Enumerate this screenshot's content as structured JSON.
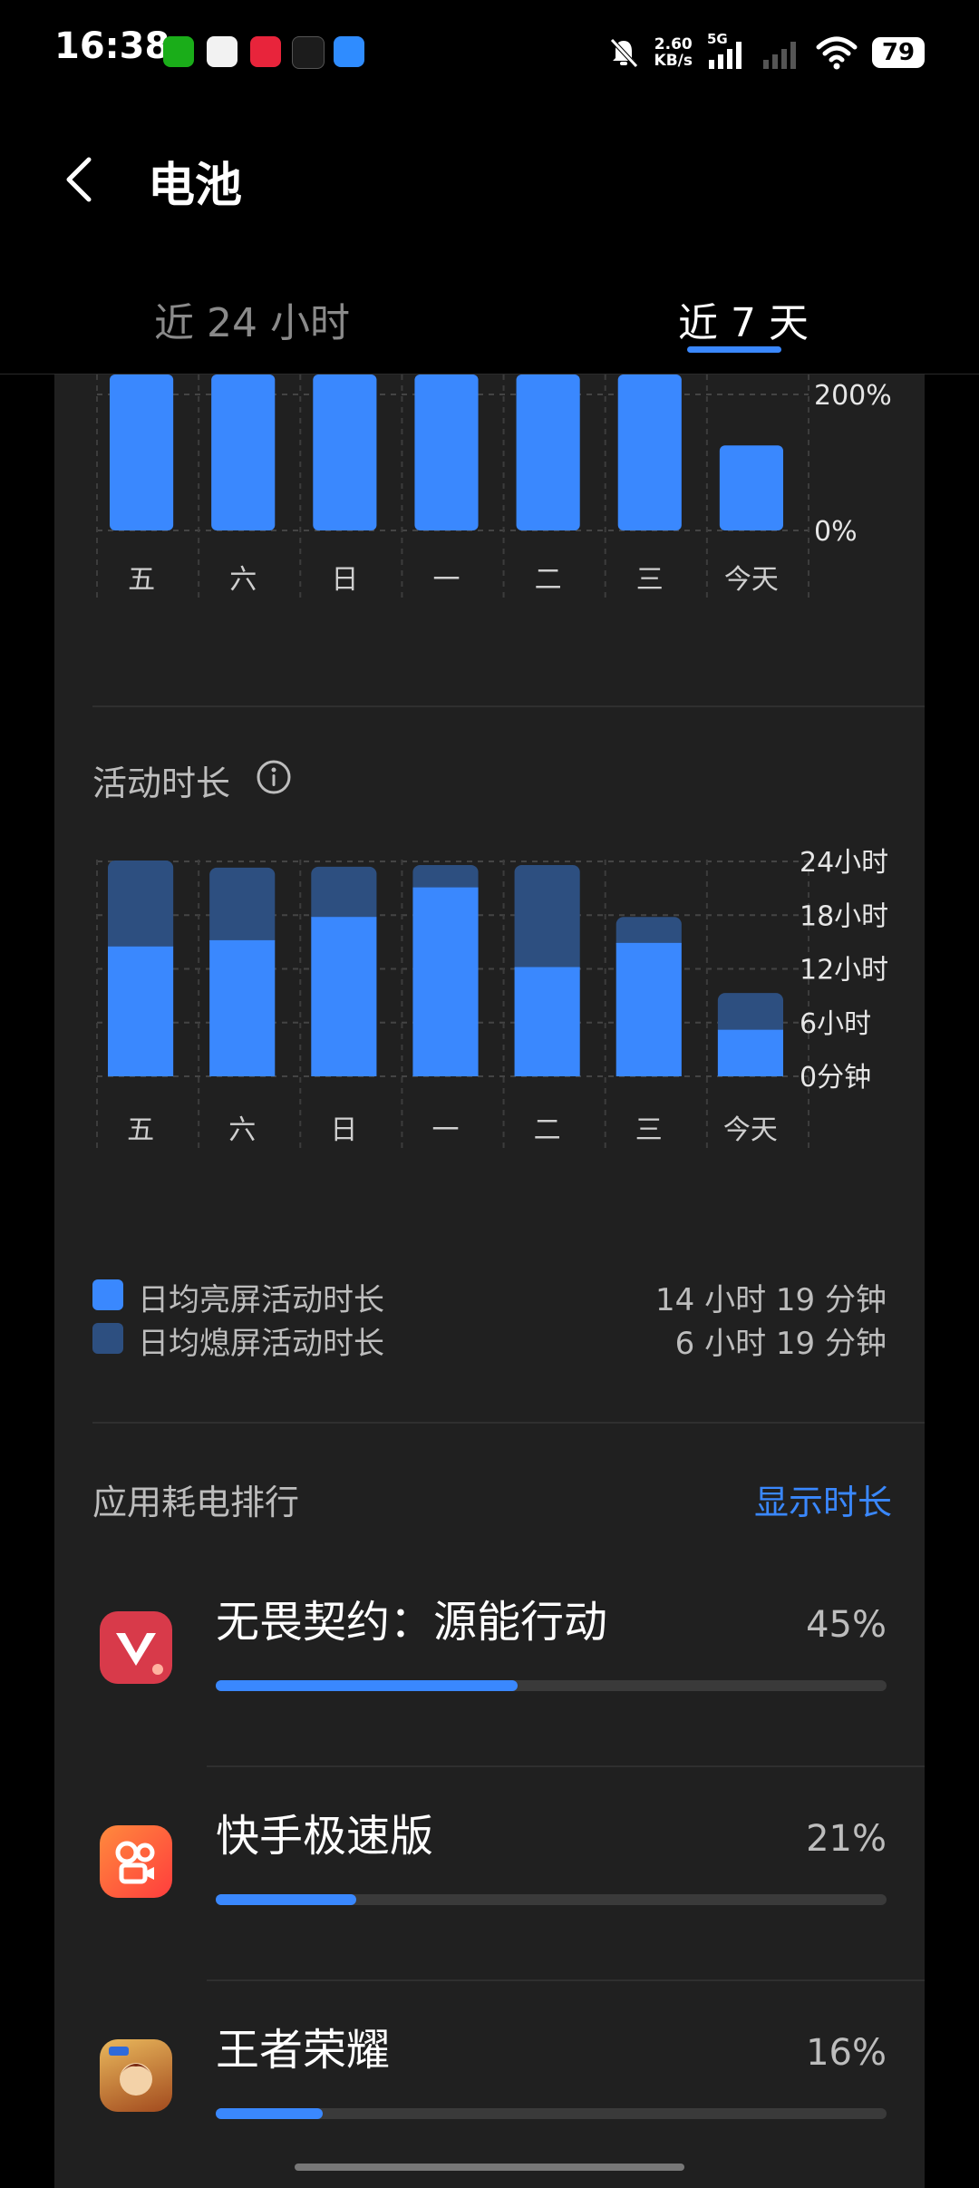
{
  "status_bar": {
    "time": "16:38",
    "net_speed_value": "2.60",
    "net_speed_unit": "KB/s",
    "network_type": "5G",
    "battery_level": "79",
    "app_icons": [
      "wechat-icon",
      "qq-icon",
      "xiaohongshu-icon",
      "dewu-icon",
      "feishu-icon"
    ],
    "right_icons": [
      "mute-bell-icon",
      "signal-icon",
      "signal-icon",
      "wifi-icon"
    ]
  },
  "header": {
    "title": "电池",
    "back_icon": "chevron-left-icon"
  },
  "tabs": [
    {
      "label": "近 24 小时",
      "active": false
    },
    {
      "label": "近 7 天",
      "active": true
    }
  ],
  "colors": {
    "accent": "#3a88fe",
    "screen_off": "#2d4f80",
    "card": "#202020",
    "background": "#000000"
  },
  "usage_chart": {
    "y_tick_labels": [
      "200%",
      "0%"
    ],
    "x_labels": [
      "五",
      "六",
      "日",
      "一",
      "二",
      "三",
      "今天"
    ]
  },
  "activity_section": {
    "title": "活动时长",
    "info_icon": "info-icon",
    "legend": [
      {
        "label": "日均亮屏活动时长",
        "value": "14 小时 19 分钟",
        "color": "#3a88fe"
      },
      {
        "label": "日均熄屏活动时长",
        "value": "6 小时 19 分钟",
        "color": "#2d4f80"
      }
    ]
  },
  "ranking": {
    "title": "应用耗电排行",
    "toggle_label": "显示时长",
    "apps": [
      {
        "name": "无畏契约：源能行动",
        "percent_label": "45%",
        "fraction": 0.45,
        "icon": "valorant-mobile-icon"
      },
      {
        "name": "快手极速版",
        "percent_label": "21%",
        "fraction": 0.21,
        "icon": "kuaishou-lite-icon"
      },
      {
        "name": "王者荣耀",
        "percent_label": "16%",
        "fraction": 0.16,
        "icon": "honor-of-kings-icon"
      }
    ]
  },
  "chart_data": [
    {
      "type": "bar",
      "categories": [
        "五",
        "六",
        "日",
        "一",
        "二",
        "三",
        "今天"
      ],
      "values": [
        290,
        290,
        290,
        290,
        290,
        290,
        125
      ],
      "ylim": [
        0,
        290
      ],
      "y_ticks": [
        0,
        200
      ],
      "tick_labels": [
        "0%",
        "200%"
      ],
      "grid": true,
      "color": "#3a88fe"
    },
    {
      "type": "bar",
      "stacked": true,
      "categories": [
        "五",
        "六",
        "日",
        "一",
        "二",
        "三",
        "今天"
      ],
      "series": [
        {
          "name": "日均亮屏活动时长",
          "values": [
            14.5,
            15.2,
            17.8,
            21.1,
            12.2,
            14.9,
            5.2
          ],
          "color": "#3a88fe"
        },
        {
          "name": "日均熄屏活动时长",
          "values": [
            9.6,
            8.1,
            5.6,
            2.5,
            11.4,
            2.9,
            4.1
          ],
          "color": "#2d4f80"
        }
      ],
      "ylim": [
        0,
        24
      ],
      "y_ticks": [
        0,
        6,
        12,
        18,
        24
      ],
      "tick_labels": [
        "0分钟",
        "6小时",
        "12小时",
        "18小时",
        "24小时"
      ],
      "grid": true
    }
  ]
}
